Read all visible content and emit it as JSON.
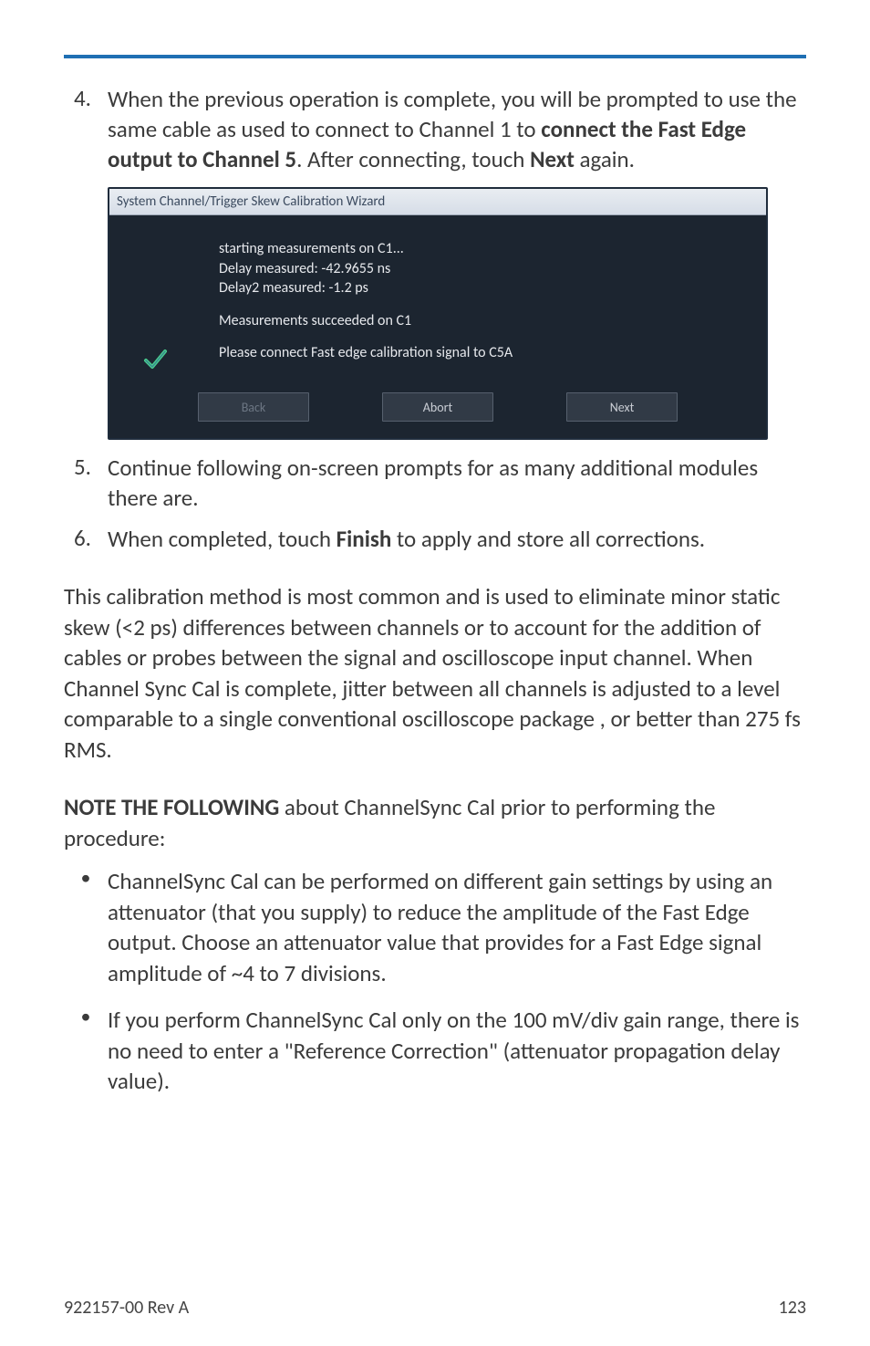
{
  "step4": {
    "num": "4.",
    "text1": "When the previous operation is complete, you will be prompted to use the same cable as used to connect to Channel 1 to ",
    "bold1": "connect the Fast Edge output  to Channel 5",
    "text2": ". After connecting, touch ",
    "bold2": "Next",
    "text3": " again."
  },
  "wizard": {
    "title": "System Channel/Trigger Skew Calibration Wizard",
    "lines": {
      "l1": "starting measurements on C1...",
      "l2": "Delay measured: -42.9655 ns",
      "l3": "Delay2 measured: -1.2 ps",
      "l4": "Measurements succeeded on C1",
      "l5": "Please connect Fast edge calibration signal to C5A"
    },
    "buttons": {
      "back": "Back",
      "abort": "Abort",
      "next": "Next"
    }
  },
  "step5": {
    "num": "5.",
    "text": "Continue following on-screen prompts for as many additional modules there are."
  },
  "step6": {
    "num": "6.",
    "text1": "When completed, touch ",
    "bold1": "Finish",
    "text2": " to apply and store all corrections."
  },
  "para1": "This calibration method is most common and is used to eliminate minor static skew (<2 ps) differences between channels or to account for the addition of cables or probes between the signal and oscilloscope input channel. When Channel Sync Cal is complete, jitter between all channels is adjusted to a level comparable to a single conventional oscilloscope package , or better than 275 fs RMS.",
  "para2": {
    "bold": "NOTE THE FOLLOWING",
    "rest": " about ChannelSync Cal prior to performing the procedure:"
  },
  "bullets": {
    "dot": "•",
    "b1": "ChannelSync Cal can be performed on different gain settings by using an attenuator (that you supply) to reduce the amplitude of the Fast Edge output.  Choose an attenuator value that provides for a Fast Edge signal amplitude of ~4 to 7 divisions.",
    "b2": "If you perform ChannelSync  Cal only on the 100 mV/div gain range, there is no need to enter a \"Reference Correction\" (attenuator propagation delay value)."
  },
  "footer": {
    "left": "922157-00 Rev A",
    "right": "123"
  }
}
